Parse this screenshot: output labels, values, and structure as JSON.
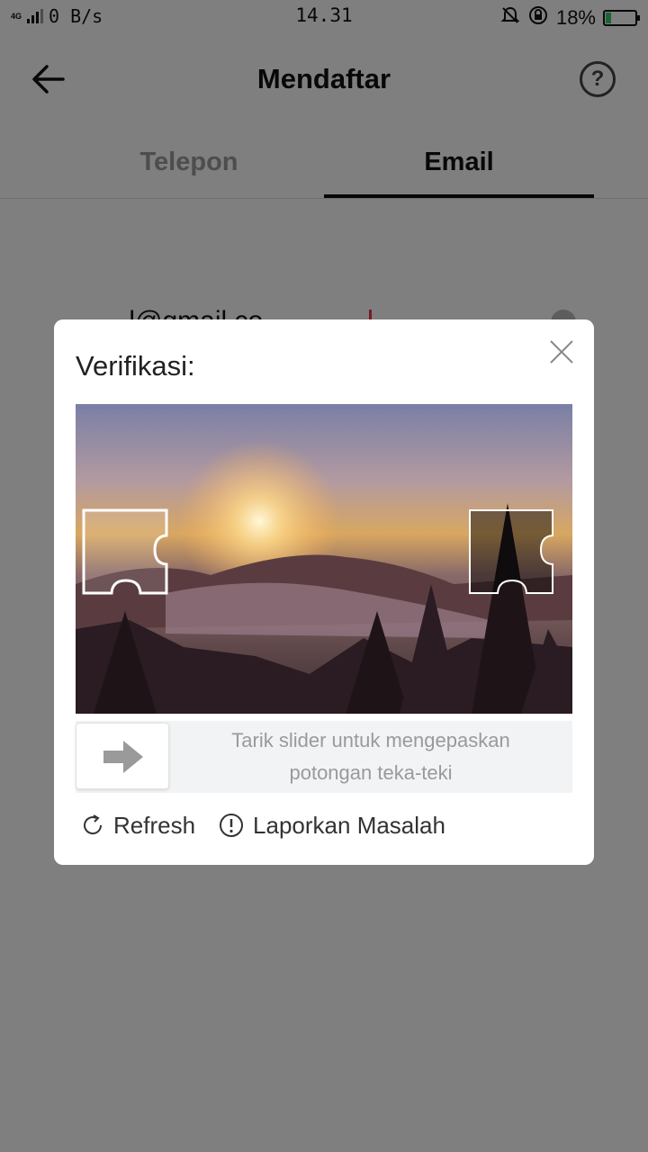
{
  "status_bar": {
    "network": "4G",
    "speed": "0 B/s",
    "time": "14.31",
    "battery": "18%",
    "battery_level": 0.18,
    "battery_color": "#2ecc71"
  },
  "header": {
    "title": "Mendaftar",
    "back_icon": "arrow-left-icon",
    "help_icon": "question-circle-icon",
    "help_glyph": "?"
  },
  "tabs": [
    {
      "label": "Telepon",
      "active": false
    },
    {
      "label": "Email",
      "active": true
    }
  ],
  "email_field": {
    "value": "..........l@gmail.co",
    "caret_color": "#e53950"
  },
  "modal": {
    "title": "Verifikasi:",
    "close_icon": "close-icon",
    "slider_hint": "Tarik slider untuk mengepaskan potongan teka-teki",
    "slider_icon": "arrow-right-icon",
    "actions": {
      "refresh": "Refresh",
      "report": "Laporkan Masalah"
    }
  }
}
